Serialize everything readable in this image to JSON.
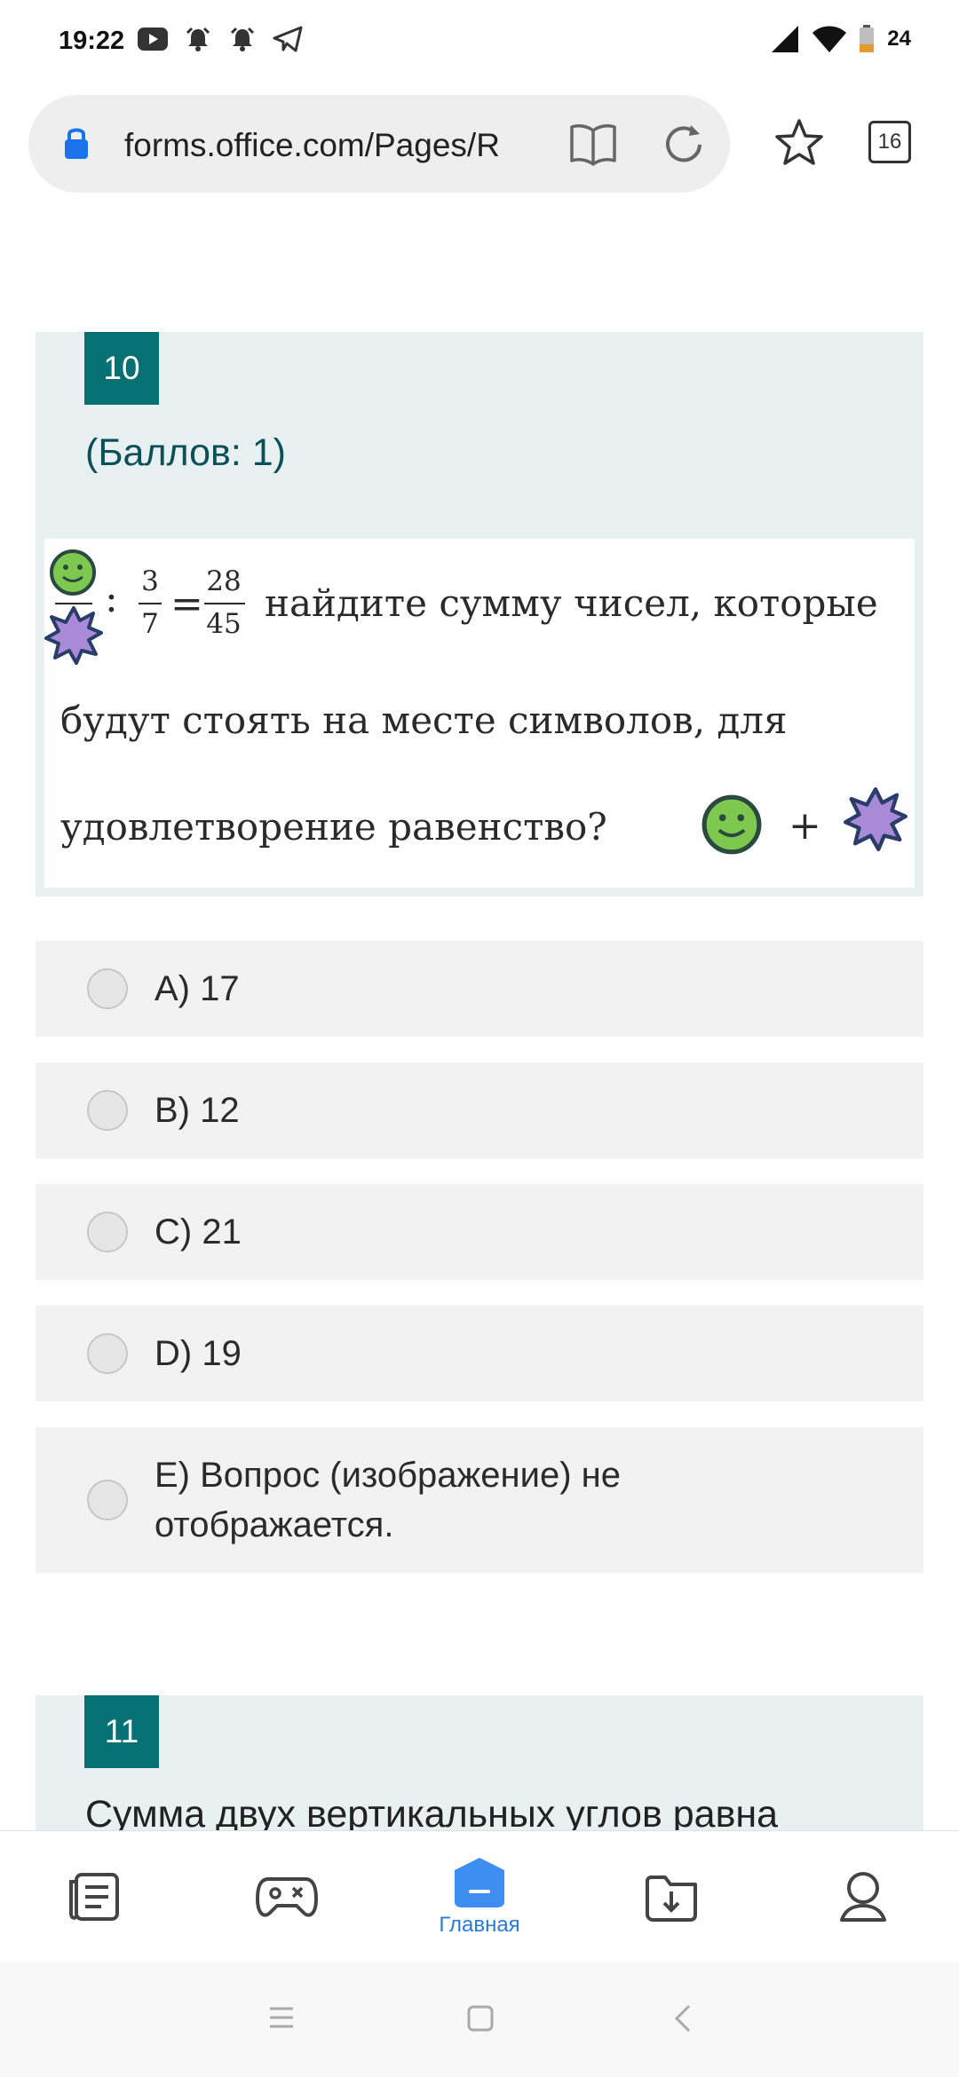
{
  "status_bar": {
    "time": "19:22",
    "battery_level": "24",
    "left_icons": [
      "youtube-icon",
      "alarm-icon",
      "alarm-icon",
      "telegram-icon"
    ],
    "right_icons": [
      "signal-icon",
      "wifi-icon",
      "battery-icon"
    ]
  },
  "browser": {
    "url": "forms.office.com/Pages/R",
    "tab_count": "16"
  },
  "question": {
    "number": "10",
    "points": "(Баллов: 1)",
    "image_text": {
      "fraction1_num": "3",
      "fraction1_den": "7",
      "fraction2_num": "28",
      "fraction2_den": "45",
      "colon": ":",
      "equals": "=",
      "line1": "найдите сумму чисел, которые",
      "line2": "будут стоять на месте символов, для",
      "line3": "удовлетворение равенство?",
      "plus": "+"
    },
    "options": [
      {
        "label": "A) 17",
        "selected": false
      },
      {
        "label": "B) 12",
        "selected": false
      },
      {
        "label": "C) 21",
        "selected": false
      },
      {
        "label": "D) 19",
        "selected": false
      },
      {
        "label_line1": "E) Вопрос (изображение) не",
        "label_line2": "отображается.",
        "selected": false
      }
    ]
  },
  "next_question": {
    "number": "11",
    "text": "Сумма двух вертикальных углов равна"
  },
  "bottom_nav": {
    "items": [
      {
        "icon": "notes-icon",
        "label": ""
      },
      {
        "icon": "gamepad-icon",
        "label": ""
      },
      {
        "icon": "home-icon",
        "label": "Главная",
        "active": true
      },
      {
        "icon": "download-icon",
        "label": ""
      },
      {
        "icon": "profile-icon",
        "label": ""
      }
    ]
  },
  "colors": {
    "accent": "#077072",
    "nav_active": "#2a7bd6",
    "header_bg": "#e9f0f2",
    "option_bg": "#f2f2f2"
  }
}
